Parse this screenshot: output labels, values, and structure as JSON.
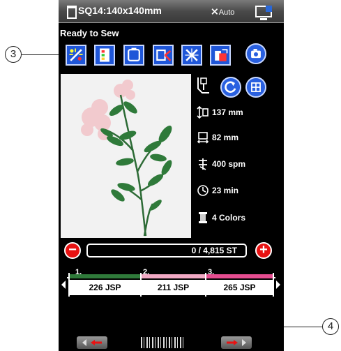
{
  "titlebar": {
    "title": "SQ14:140x140mm",
    "auto_label": "Auto"
  },
  "status_text": "Ready to Sew",
  "toolbar": {
    "tools": [
      "color-sort-icon",
      "color-list-icon",
      "hoop-icon",
      "trim-icon",
      "move-icon",
      "color-change-icon"
    ],
    "side_buttons": [
      "camera-icon",
      "rotate-icon",
      "grid-icon"
    ]
  },
  "info": {
    "height": "137 mm",
    "width": "82 mm",
    "speed": "400 spm",
    "time": "23 min",
    "colors": "4 Colors"
  },
  "stitch": {
    "counter": "0 / 4,815 ST",
    "minus": "−",
    "plus": "+"
  },
  "colors": [
    {
      "num": "1.",
      "value": "226 JSP",
      "color": "#2f7a3a"
    },
    {
      "num": "2.",
      "value": "211 JSP",
      "color": "#f1a9c4"
    },
    {
      "num": "3.",
      "value": "265 JSP",
      "color": "#e64d90"
    }
  ],
  "callouts": {
    "c3": "3",
    "c4": "4"
  },
  "accent": "#1f56d8",
  "danger": "#e81212"
}
